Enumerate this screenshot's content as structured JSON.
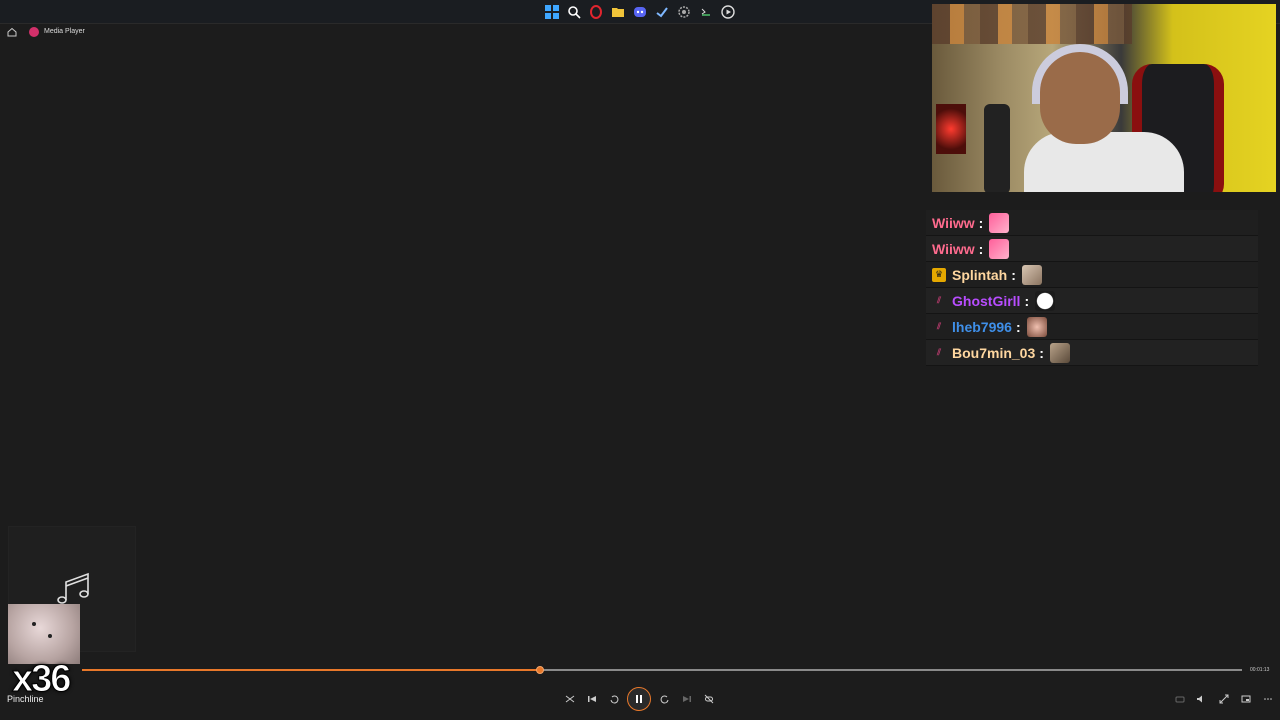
{
  "taskbar": {
    "icons": [
      "windows-icon",
      "search-icon",
      "opera-icon",
      "folder-icon",
      "discord-icon",
      "steam-icon",
      "settings-icon",
      "terminal-icon",
      "media-player-icon"
    ]
  },
  "app": {
    "title": "Media Player"
  },
  "chat": {
    "messages": [
      {
        "user": "Wiiww",
        "color": "#ff6b8e",
        "badge": "",
        "emote": "pink-emote"
      },
      {
        "user": "Wiiww",
        "color": "#ff6b8e",
        "badge": "",
        "emote": "pink-emote"
      },
      {
        "user": "Splintah",
        "color": "#ffd7a0",
        "badge": "crown",
        "emote": "dog-emote"
      },
      {
        "user": "GhostGirll",
        "color": "#b84dff",
        "badge": "slash",
        "emote": "ghost-emote"
      },
      {
        "user": "lheb7996",
        "color": "#3f8fe8",
        "badge": "slash",
        "emote": "thumbs-emote"
      },
      {
        "user": "Bou7min_03",
        "color": "#ffd7a0",
        "badge": "slash",
        "emote": "face-emote"
      }
    ]
  },
  "player": {
    "track_title": "Pinchline",
    "combo_text": "x36",
    "time_remaining": "00:01:13",
    "progress_fraction": 0.395,
    "accent": "#e8782a"
  }
}
